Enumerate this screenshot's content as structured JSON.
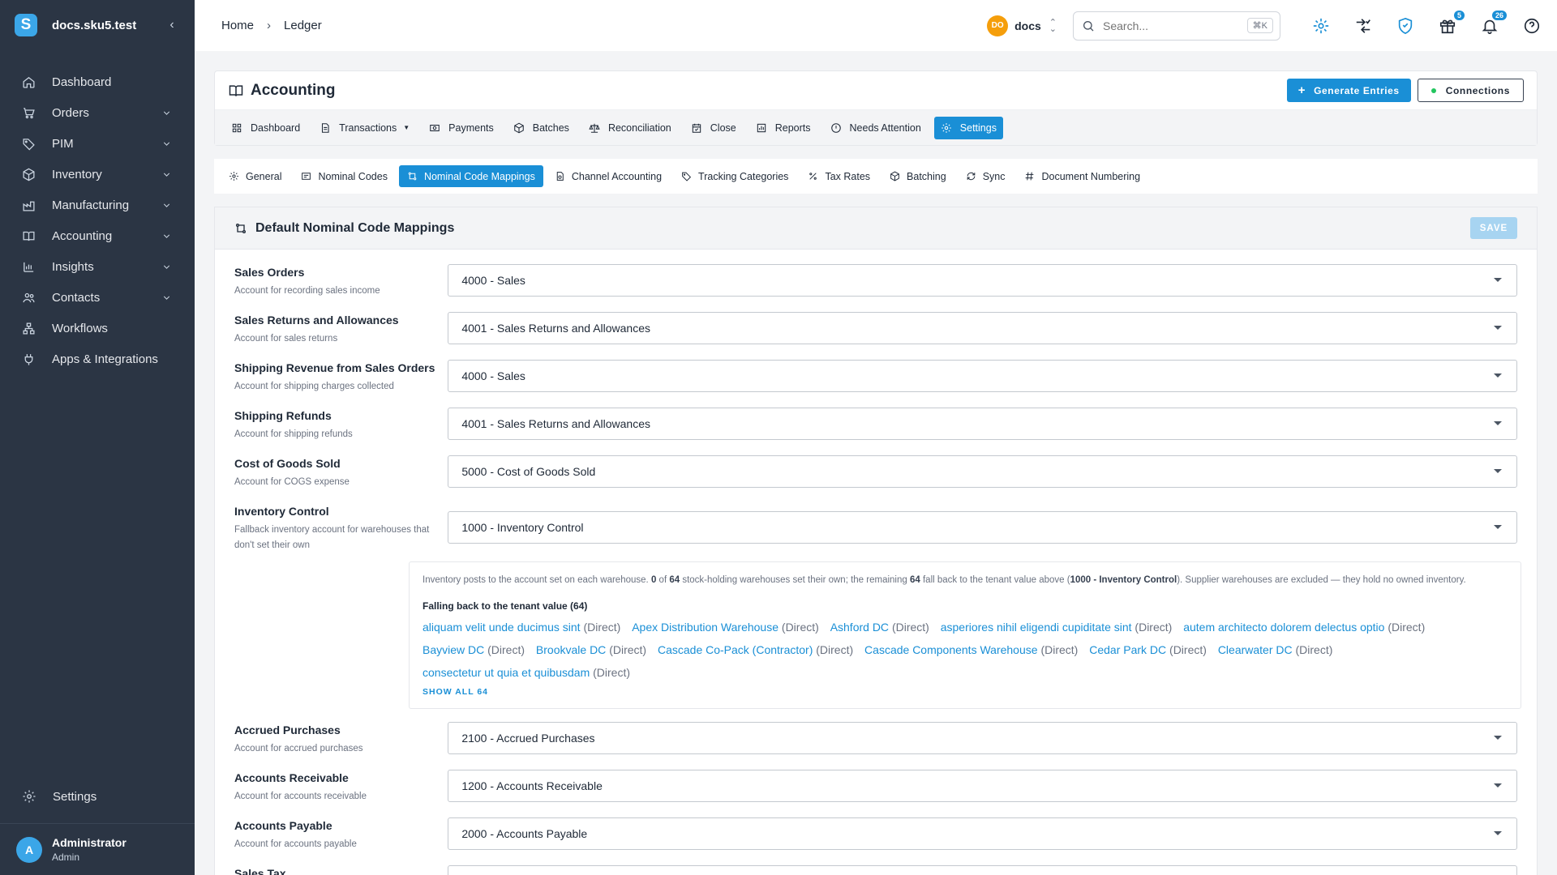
{
  "sidebar": {
    "logo_letter": "S",
    "domain": "docs.sku5.test",
    "items": [
      {
        "label": "Dashboard",
        "icon": "home-icon",
        "expandable": false
      },
      {
        "label": "Orders",
        "icon": "cart-icon",
        "expandable": true
      },
      {
        "label": "PIM",
        "icon": "tag-icon",
        "expandable": true
      },
      {
        "label": "Inventory",
        "icon": "box-icon",
        "expandable": true
      },
      {
        "label": "Manufacturing",
        "icon": "factory-icon",
        "expandable": true
      },
      {
        "label": "Accounting",
        "icon": "book-icon",
        "expandable": true
      },
      {
        "label": "Insights",
        "icon": "bar-chart-icon",
        "expandable": true
      },
      {
        "label": "Contacts",
        "icon": "people-icon",
        "expandable": true
      },
      {
        "label": "Workflows",
        "icon": "workflow-icon",
        "expandable": false
      },
      {
        "label": "Apps & Integrations",
        "icon": "plug-icon",
        "expandable": false
      }
    ],
    "settings_label": "Settings",
    "user": {
      "initial": "A",
      "name": "Administrator",
      "role": "Admin"
    }
  },
  "header": {
    "breadcrumbs": [
      "Home",
      "Ledger"
    ],
    "tenant": {
      "initials": "DO",
      "name": "docs"
    },
    "search": {
      "placeholder": "Search...",
      "shortcut": "⌘K"
    },
    "badges": {
      "gifts": "5",
      "notifications": "26"
    }
  },
  "page": {
    "title": "Accounting",
    "actions": {
      "generate": "Generate Entries",
      "connections": "Connections"
    },
    "tabs": [
      "Dashboard",
      "Transactions",
      "Payments",
      "Batches",
      "Reconciliation",
      "Close",
      "Reports",
      "Needs Attention",
      "Settings"
    ],
    "active_tab": "Settings",
    "subtabs": [
      "General",
      "Nominal Codes",
      "Nominal Code Mappings",
      "Channel Accounting",
      "Tracking Categories",
      "Tax Rates",
      "Batching",
      "Sync",
      "Document Numbering"
    ],
    "active_subtab": "Nominal Code Mappings"
  },
  "section": {
    "title": "Default Nominal Code Mappings",
    "save_label": "SAVE",
    "rows": [
      {
        "label": "Sales Orders",
        "desc": "Account for recording sales income",
        "value": "4000 - Sales"
      },
      {
        "label": "Sales Returns and Allowances",
        "desc": "Account for sales returns",
        "value": "4001 - Sales Returns and Allowances"
      },
      {
        "label": "Shipping Revenue from Sales Orders",
        "desc": "Account for shipping charges collected",
        "value": "4000 - Sales"
      },
      {
        "label": "Shipping Refunds",
        "desc": "Account for shipping refunds",
        "value": "4001 - Sales Returns and Allowances"
      },
      {
        "label": "Cost of Goods Sold",
        "desc": "Account for COGS expense",
        "value": "5000 - Cost of Goods Sold"
      },
      {
        "label": "Inventory Control",
        "desc": "Fallback inventory account for warehouses that don't set their own",
        "value": "1000 - Inventory Control"
      }
    ],
    "inventory_info": {
      "p1": "Inventory posts to the account set on each warehouse.",
      "set_count": "0",
      "of": "of",
      "total": "64",
      "p2": "stock-holding warehouses set their own; the remaining",
      "fallback_count": "64",
      "p3": "fall back to the tenant value above (",
      "tenant_value": "1000 - Inventory Control",
      "p4": "). Supplier warehouses are excluded — they hold no owned inventory.",
      "falling_back_title": "Falling back to the tenant value (64)",
      "warehouses": [
        {
          "name": "aliquam velit unde ducimus sint",
          "kind": "(Direct)"
        },
        {
          "name": "Apex Distribution Warehouse",
          "kind": "(Direct)"
        },
        {
          "name": "Ashford DC",
          "kind": "(Direct)"
        },
        {
          "name": "asperiores nihil eligendi cupiditate sint",
          "kind": "(Direct)"
        },
        {
          "name": "autem architecto dolorem delectus optio",
          "kind": "(Direct)"
        },
        {
          "name": "Bayview DC",
          "kind": "(Direct)"
        },
        {
          "name": "Brookvale DC",
          "kind": "(Direct)"
        },
        {
          "name": "Cascade Co-Pack (Contractor)",
          "kind": "(Direct)"
        },
        {
          "name": "Cascade Components Warehouse",
          "kind": "(Direct)"
        },
        {
          "name": "Cedar Park DC",
          "kind": "(Direct)"
        },
        {
          "name": "Clearwater DC",
          "kind": "(Direct)"
        },
        {
          "name": "consectetur ut quia et quibusdam",
          "kind": "(Direct)"
        }
      ],
      "show_all": "SHOW ALL 64"
    },
    "rows_after": [
      {
        "label": "Accrued Purchases",
        "desc": "Account for accrued purchases",
        "value": "2100 - Accrued Purchases"
      },
      {
        "label": "Accounts Receivable",
        "desc": "Account for accounts receivable",
        "value": "1200 - Accounts Receivable"
      },
      {
        "label": "Accounts Payable",
        "desc": "Account for accounts payable",
        "value": "2000 - Accounts Payable"
      },
      {
        "label": "Sales Tax",
        "desc": "",
        "value": ""
      }
    ]
  },
  "colors": {
    "accent": "#1a8fd6",
    "sidebar": "#2b3544",
    "tenant_badge": "#f59e0b"
  }
}
